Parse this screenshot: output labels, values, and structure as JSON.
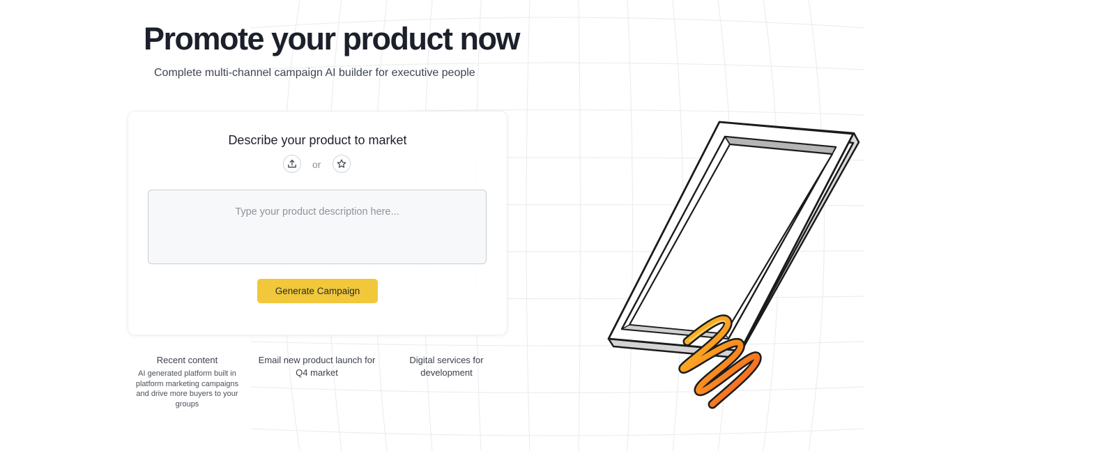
{
  "hero": {
    "title": "Promote your product now",
    "subtitle": "Complete multi-channel campaign AI builder for executive people"
  },
  "card": {
    "title": "Describe your product to market",
    "upload_icon": "upload-icon",
    "or_text": "or",
    "star_icon": "star-icon",
    "input_placeholder": "Type your product description here...",
    "input_value": "",
    "generate_label": "Generate Campaign"
  },
  "suggestions": [
    {
      "title": "Recent content",
      "description": "AI generated platform built in platform marketing campaigns and drive more buyers to your groups"
    },
    {
      "title": "Email new product launch for Q4 market",
      "description": ""
    },
    {
      "title": "Digital services for development",
      "description": ""
    }
  ],
  "illustration": {
    "name": "phone-with-coil-illustration"
  },
  "colors": {
    "accent": "#f1c83b",
    "title": "#1c202b",
    "coil_light": "#ffc21f",
    "coil_dark": "#f25a24"
  }
}
